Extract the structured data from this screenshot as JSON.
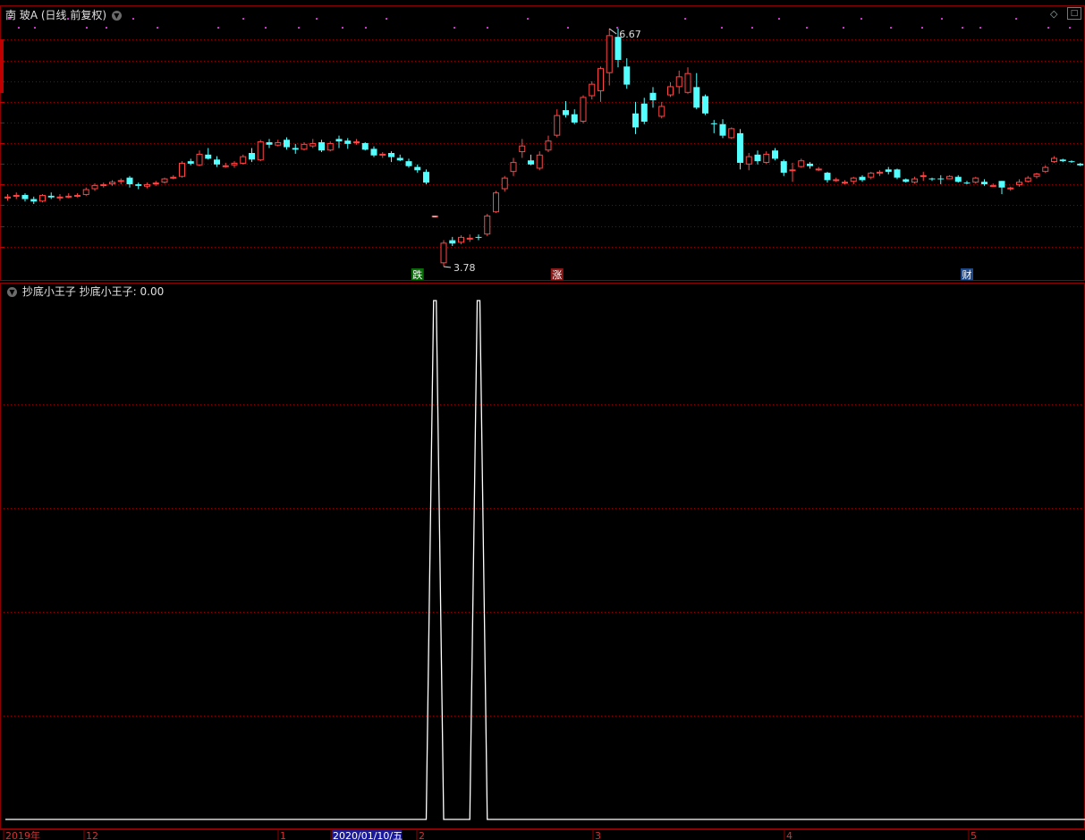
{
  "main": {
    "title": "南 玻A",
    "mode": "(日线 前复权)",
    "high_label": "6.67",
    "low_label": "3.78",
    "dash_label": "–",
    "markers": [
      {
        "text": "跌",
        "bg": "#0a6b0a"
      },
      {
        "text": "涨",
        "bg": "#8b1a1a"
      },
      {
        "text": "财",
        "bg": "#1e4a8a"
      }
    ]
  },
  "sub": {
    "indicator_name": "抄底小王子",
    "value_label": "抄底小王子: 0.00"
  },
  "axis": {
    "labels": [
      "2019年",
      "12",
      "1",
      "2020/01/10/五",
      "2",
      "3",
      "4",
      "5"
    ]
  },
  "colors": {
    "up": "#ff4444",
    "down": "#54ffff",
    "grid": "#8b0000",
    "dot": "#cc33cc",
    "line": "#ffffff"
  },
  "chart_data": [
    {
      "type": "candlestick",
      "title": "南 玻A (日线 前复权)",
      "series": [
        {
          "name": "南 玻A",
          "ohlc": [
            [
              4.62,
              4.66,
              4.58,
              4.63
            ],
            [
              4.64,
              4.68,
              4.6,
              4.65
            ],
            [
              4.65,
              4.67,
              4.57,
              4.6
            ],
            [
              4.6,
              4.63,
              4.54,
              4.57
            ],
            [
              4.57,
              4.66,
              4.56,
              4.65
            ],
            [
              4.64,
              4.68,
              4.6,
              4.62
            ],
            [
              4.62,
              4.66,
              4.58,
              4.63
            ],
            [
              4.63,
              4.67,
              4.61,
              4.64
            ],
            [
              4.64,
              4.67,
              4.62,
              4.65
            ],
            [
              4.65,
              4.74,
              4.64,
              4.72
            ],
            [
              4.72,
              4.79,
              4.7,
              4.77
            ],
            [
              4.77,
              4.8,
              4.74,
              4.78
            ],
            [
              4.78,
              4.83,
              4.76,
              4.81
            ],
            [
              4.81,
              4.85,
              4.78,
              4.83
            ],
            [
              4.86,
              4.88,
              4.74,
              4.78
            ],
            [
              4.78,
              4.8,
              4.72,
              4.76
            ],
            [
              4.75,
              4.8,
              4.73,
              4.78
            ],
            [
              4.78,
              4.82,
              4.76,
              4.8
            ],
            [
              4.8,
              4.86,
              4.79,
              4.85
            ],
            [
              4.86,
              4.89,
              4.84,
              4.87
            ],
            [
              4.87,
              5.06,
              4.86,
              5.04
            ],
            [
              5.06,
              5.09,
              5.01,
              5.03
            ],
            [
              5.01,
              5.19,
              5.0,
              5.15
            ],
            [
              5.14,
              5.22,
              5.08,
              5.09
            ],
            [
              5.08,
              5.12,
              4.99,
              5.02
            ],
            [
              5.01,
              5.04,
              4.98,
              5.01
            ],
            [
              5.01,
              5.06,
              4.98,
              5.04
            ],
            [
              5.03,
              5.14,
              5.02,
              5.12
            ],
            [
              5.16,
              5.22,
              5.05,
              5.08
            ],
            [
              5.07,
              5.32,
              5.06,
              5.3
            ],
            [
              5.29,
              5.33,
              5.22,
              5.26
            ],
            [
              5.25,
              5.32,
              5.24,
              5.29
            ],
            [
              5.32,
              5.35,
              5.2,
              5.23
            ],
            [
              5.22,
              5.27,
              5.15,
              5.2
            ],
            [
              5.2,
              5.29,
              5.19,
              5.27
            ],
            [
              5.24,
              5.33,
              5.22,
              5.28
            ],
            [
              5.29,
              5.32,
              5.17,
              5.19
            ],
            [
              5.19,
              5.3,
              5.18,
              5.28
            ],
            [
              5.33,
              5.37,
              5.22,
              5.3
            ],
            [
              5.31,
              5.34,
              5.21,
              5.27
            ],
            [
              5.28,
              5.33,
              5.26,
              5.3
            ],
            [
              5.28,
              5.29,
              5.19,
              5.2
            ],
            [
              5.21,
              5.24,
              5.11,
              5.13
            ],
            [
              5.13,
              5.17,
              5.1,
              5.15
            ],
            [
              5.16,
              5.18,
              5.05,
              5.11
            ],
            [
              5.1,
              5.14,
              5.06,
              5.07
            ],
            [
              5.06,
              5.09,
              4.98,
              5.0
            ],
            [
              4.99,
              5.02,
              4.92,
              4.95
            ],
            [
              4.93,
              4.96,
              4.78,
              4.8
            ],
            [
              4.4,
              4.4,
              4.4,
              4.4
            ],
            [
              3.82,
              4.1,
              3.78,
              4.07
            ],
            [
              4.1,
              4.14,
              4.03,
              4.06
            ],
            [
              4.07,
              4.16,
              4.05,
              4.14
            ],
            [
              4.12,
              4.17,
              4.08,
              4.13
            ],
            [
              4.14,
              4.17,
              4.1,
              4.13
            ],
            [
              4.17,
              4.42,
              4.15,
              4.4
            ],
            [
              4.44,
              4.7,
              4.43,
              4.68
            ],
            [
              4.72,
              4.88,
              4.69,
              4.86
            ],
            [
              4.93,
              5.1,
              4.88,
              5.05
            ],
            [
              5.17,
              5.33,
              5.1,
              5.25
            ],
            [
              5.07,
              5.14,
              5.01,
              5.02
            ],
            [
              4.97,
              5.18,
              4.95,
              5.14
            ],
            [
              5.19,
              5.37,
              5.17,
              5.31
            ],
            [
              5.37,
              5.69,
              5.35,
              5.62
            ],
            [
              5.68,
              5.79,
              5.59,
              5.62
            ],
            [
              5.63,
              5.69,
              5.51,
              5.53
            ],
            [
              5.54,
              5.86,
              5.52,
              5.84
            ],
            [
              5.85,
              6.03,
              5.81,
              6.0
            ],
            [
              5.91,
              6.21,
              5.78,
              6.19
            ],
            [
              6.13,
              6.67,
              5.98,
              6.59
            ],
            [
              6.57,
              6.67,
              6.2,
              6.29
            ],
            [
              6.21,
              6.31,
              5.94,
              5.99
            ],
            [
              5.64,
              5.78,
              5.39,
              5.47
            ],
            [
              5.76,
              5.83,
              5.51,
              5.54
            ],
            [
              5.89,
              5.96,
              5.71,
              5.8
            ],
            [
              5.6,
              5.78,
              5.58,
              5.73
            ],
            [
              5.86,
              6.02,
              5.84,
              5.97
            ],
            [
              5.96,
              6.16,
              5.88,
              6.09
            ],
            [
              5.89,
              6.2,
              5.88,
              6.13
            ],
            [
              5.96,
              6.13,
              5.69,
              5.71
            ],
            [
              5.85,
              5.87,
              5.62,
              5.64
            ],
            [
              5.52,
              5.56,
              5.4,
              5.51
            ],
            [
              5.51,
              5.57,
              5.34,
              5.37
            ],
            [
              5.34,
              5.47,
              5.33,
              5.46
            ],
            [
              5.4,
              5.45,
              4.96,
              5.04
            ],
            [
              5.02,
              5.16,
              4.95,
              5.12
            ],
            [
              5.14,
              5.19,
              5.02,
              5.06
            ],
            [
              5.04,
              5.18,
              5.03,
              5.15
            ],
            [
              5.19,
              5.22,
              5.07,
              5.09
            ],
            [
              5.06,
              5.08,
              4.88,
              4.92
            ],
            [
              4.96,
              5.04,
              4.81,
              4.96
            ],
            [
              4.99,
              5.09,
              4.98,
              5.07
            ],
            [
              5.03,
              5.05,
              4.97,
              5.0
            ],
            [
              4.96,
              4.99,
              4.94,
              4.97
            ],
            [
              4.92,
              4.93,
              4.8,
              4.83
            ],
            [
              4.83,
              4.86,
              4.81,
              4.84
            ],
            [
              4.8,
              4.83,
              4.78,
              4.81
            ],
            [
              4.81,
              4.87,
              4.78,
              4.86
            ],
            [
              4.87,
              4.89,
              4.81,
              4.83
            ],
            [
              4.86,
              4.93,
              4.84,
              4.92
            ],
            [
              4.93,
              4.95,
              4.88,
              4.93
            ],
            [
              4.96,
              4.99,
              4.9,
              4.93
            ],
            [
              4.96,
              4.97,
              4.84,
              4.86
            ],
            [
              4.84,
              4.85,
              4.8,
              4.81
            ],
            [
              4.8,
              4.87,
              4.79,
              4.85
            ],
            [
              4.88,
              4.93,
              4.82,
              4.89
            ],
            [
              4.85,
              4.86,
              4.82,
              4.84
            ],
            [
              4.85,
              4.89,
              4.78,
              4.84
            ],
            [
              4.84,
              4.89,
              4.84,
              4.88
            ],
            [
              4.87,
              4.89,
              4.8,
              4.81
            ],
            [
              4.8,
              4.82,
              4.78,
              4.79
            ],
            [
              4.8,
              4.87,
              4.79,
              4.86
            ],
            [
              4.81,
              4.84,
              4.76,
              4.78
            ],
            [
              4.76,
              4.79,
              4.75,
              4.77
            ],
            [
              4.82,
              4.82,
              4.66,
              4.74
            ],
            [
              4.72,
              4.75,
              4.7,
              4.74
            ],
            [
              4.77,
              4.84,
              4.75,
              4.81
            ],
            [
              4.81,
              4.88,
              4.8,
              4.86
            ],
            [
              4.87,
              4.92,
              4.85,
              4.91
            ],
            [
              4.93,
              5.01,
              4.92,
              4.99
            ],
            [
              5.05,
              5.12,
              5.04,
              5.1
            ],
            [
              5.08,
              5.09,
              5.05,
              5.06
            ],
            [
              5.06,
              5.07,
              5.04,
              5.05
            ],
            [
              5.03,
              5.04,
              5.0,
              5.01
            ],
            [
              5.02,
              5.04,
              4.99,
              5.0
            ],
            [
              4.98,
              5.03,
              4.97,
              5.01
            ],
            [
              5.0,
              5.05,
              4.98,
              5.03
            ],
            [
              5.04,
              5.07,
              5.03,
              5.05
            ]
          ]
        }
      ],
      "high": 6.67,
      "low": 3.78
    },
    {
      "type": "line",
      "title": "抄底小王子",
      "series": [
        {
          "name": "抄底小王子",
          "values": [
            0,
            0,
            0,
            0,
            0,
            0,
            0,
            0,
            0,
            0,
            0,
            0,
            0,
            0,
            0,
            0,
            0,
            0,
            0,
            0,
            0,
            0,
            0,
            0,
            0,
            0,
            0,
            0,
            0,
            0,
            0,
            0,
            0,
            0,
            0,
            0,
            0,
            0,
            0,
            0,
            0,
            0,
            0,
            0,
            0,
            0,
            0,
            0,
            0,
            1,
            0,
            0,
            0,
            0,
            1,
            0,
            0,
            0,
            0,
            0,
            0,
            0,
            0,
            0,
            0,
            0,
            0,
            0,
            0,
            0,
            0,
            0,
            0,
            0,
            0,
            0,
            0,
            0,
            0,
            0,
            0,
            0,
            0,
            0,
            0,
            0,
            0,
            0,
            0,
            0,
            0,
            0,
            0,
            0,
            0,
            0,
            0,
            0,
            0,
            0,
            0,
            0,
            0,
            0,
            0,
            0,
            0,
            0,
            0,
            0,
            0,
            0,
            0,
            0,
            0,
            0,
            0,
            0,
            0,
            0,
            0,
            0,
            0,
            0,
            0,
            0,
            0,
            0
          ]
        }
      ],
      "current": 0.0
    }
  ]
}
